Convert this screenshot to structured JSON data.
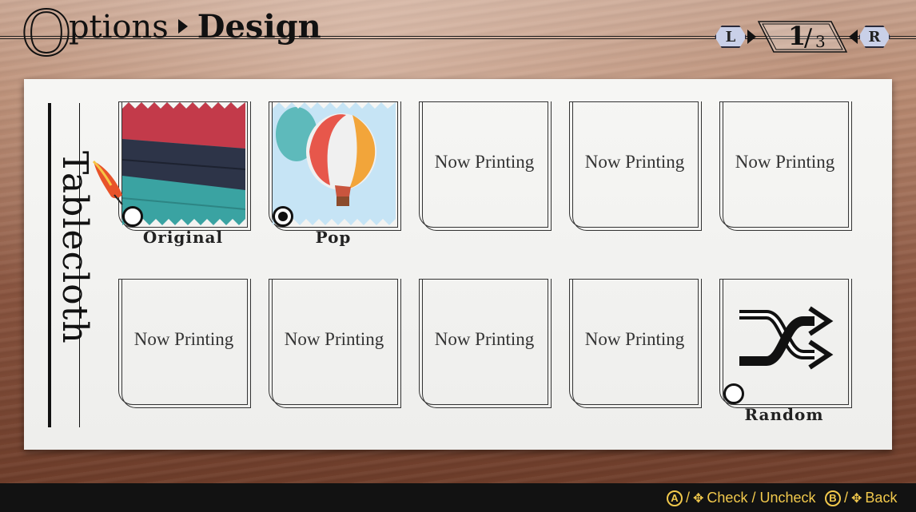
{
  "header": {
    "title_initial": "O",
    "title_rest": "ptions",
    "subtitle": "Design",
    "pager": {
      "left_button": "L",
      "right_button": "R",
      "current": "1",
      "total": "3"
    }
  },
  "section_label": "Tablecloth",
  "tiles": [
    {
      "label": "Original",
      "placeholder": ""
    },
    {
      "label": "Pop",
      "placeholder": "",
      "selected": true
    },
    {
      "label": "",
      "placeholder": "Now Printing"
    },
    {
      "label": "",
      "placeholder": "Now Printing"
    },
    {
      "label": "",
      "placeholder": "Now Printing"
    },
    {
      "label": "",
      "placeholder": "Now Printing"
    },
    {
      "label": "",
      "placeholder": "Now Printing"
    },
    {
      "label": "",
      "placeholder": "Now Printing"
    },
    {
      "label": "",
      "placeholder": "Now Printing"
    },
    {
      "label": "Random",
      "placeholder": ""
    }
  ],
  "footer": {
    "check_button": "A",
    "check_label": "Check / Uncheck",
    "back_button": "B",
    "back_label": "Back"
  },
  "icons": {
    "pointer": "feather-pointer-icon",
    "random": "shuffle-icon",
    "dpad": "dpad-icon"
  },
  "colors": {
    "hint_text": "#f2c94c",
    "pager_button": "#c9d0e8",
    "swatch_red": "#c33a4a",
    "swatch_navy": "#2d3448",
    "swatch_teal": "#3aa3a2",
    "pop_background": "#c6e4f5"
  }
}
